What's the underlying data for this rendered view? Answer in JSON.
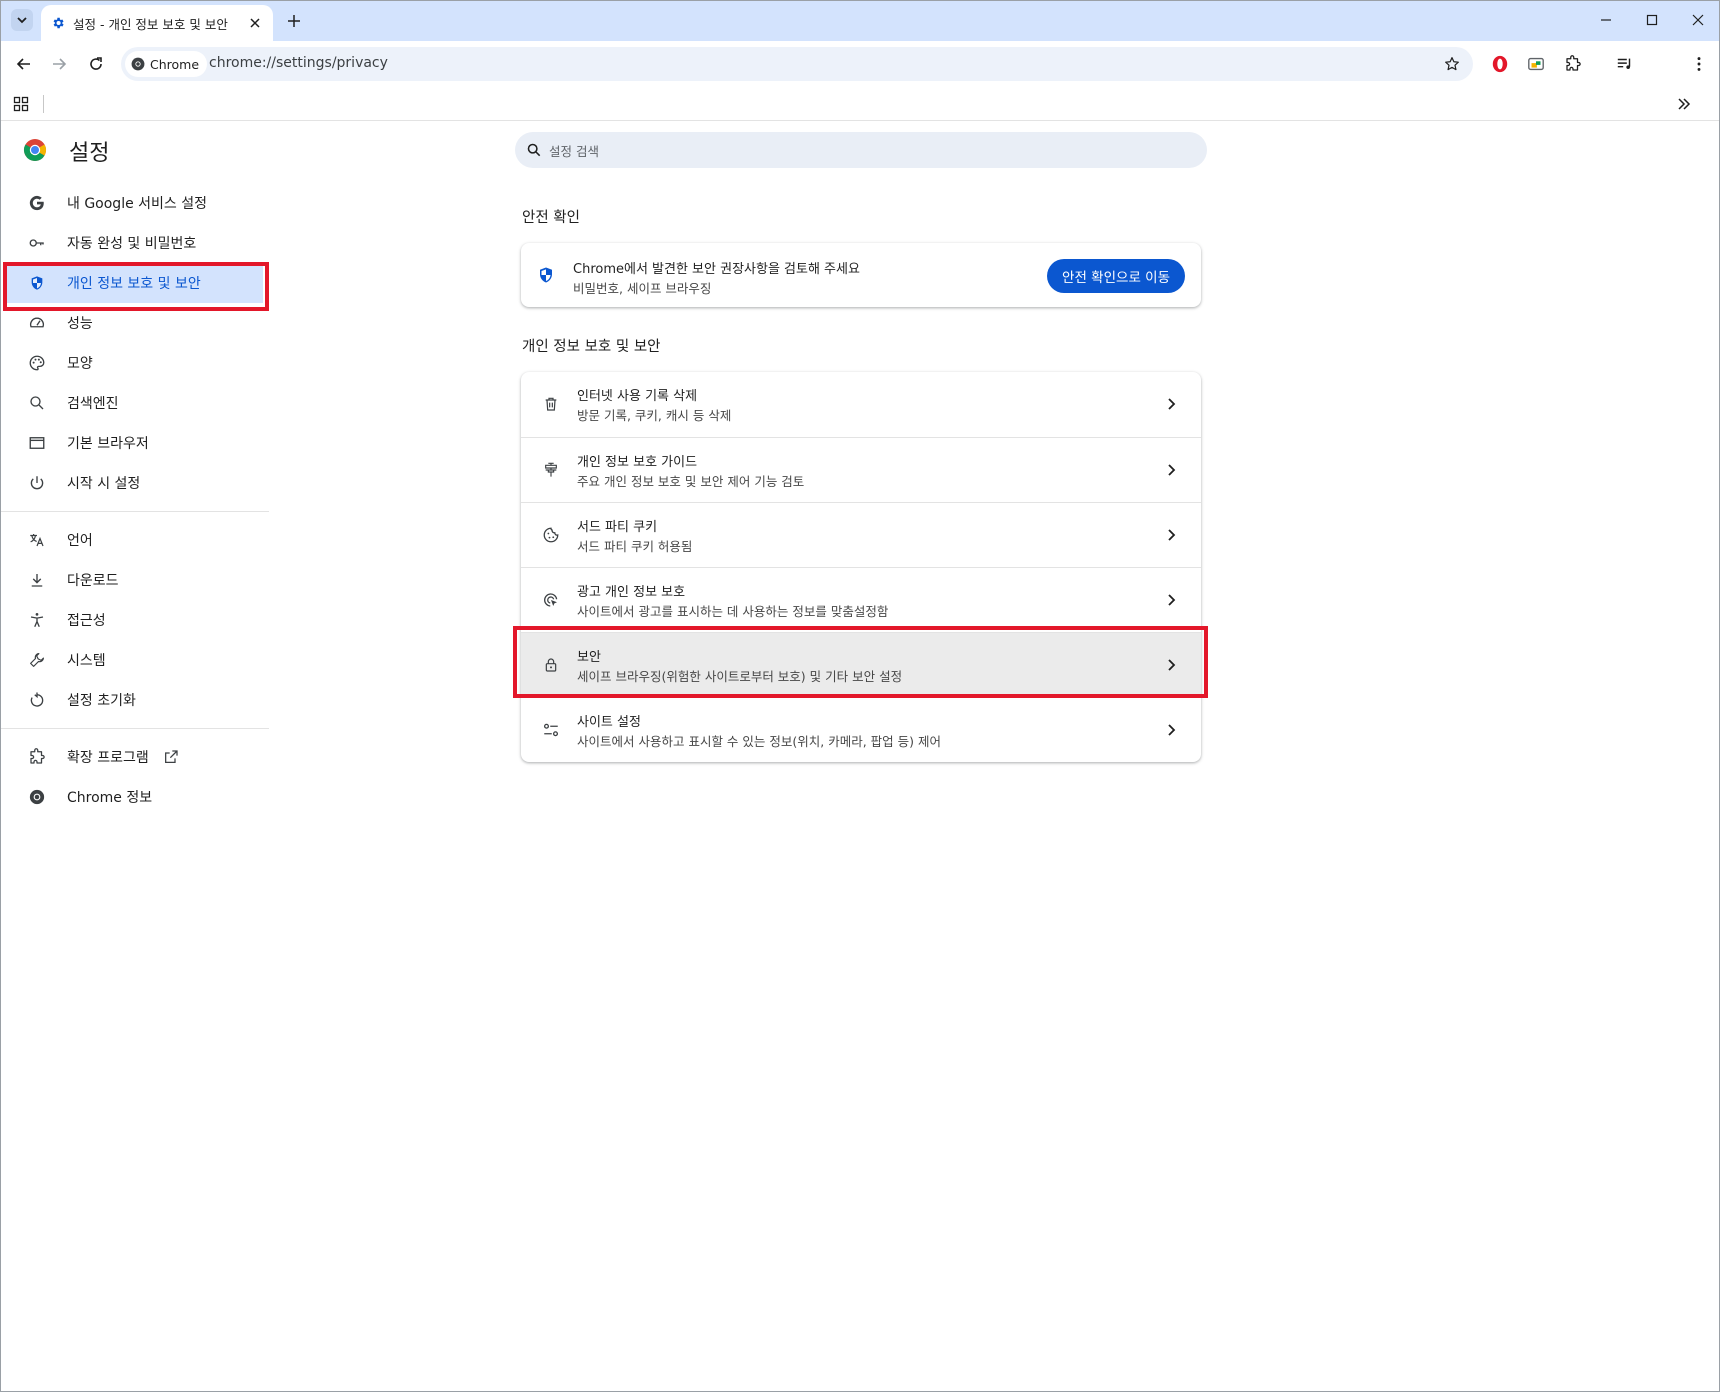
{
  "browser": {
    "tab_title": "설정 - 개인 정보 보호 및 보안",
    "chip_label": "Chrome",
    "url": "chrome://settings/privacy"
  },
  "settings": {
    "title": "설정",
    "search_placeholder": "설정 검색"
  },
  "sidebar": {
    "items": [
      {
        "label": "내 Google 서비스 설정",
        "icon": "google-g-icon"
      },
      {
        "label": "자동 완성 및 비밀번호",
        "icon": "key-icon"
      },
      {
        "label": "개인 정보 보호 및 보안",
        "icon": "shield-icon",
        "active": true
      },
      {
        "label": "성능",
        "icon": "speedometer-icon"
      },
      {
        "label": "모양",
        "icon": "palette-icon"
      },
      {
        "label": "검색엔진",
        "icon": "search-icon"
      },
      {
        "label": "기본 브라우저",
        "icon": "browser-window-icon"
      },
      {
        "label": "시작 시 설정",
        "icon": "power-icon"
      }
    ],
    "items2": [
      {
        "label": "언어",
        "icon": "translate-icon"
      },
      {
        "label": "다운로드",
        "icon": "download-icon"
      },
      {
        "label": "접근성",
        "icon": "accessibility-icon"
      },
      {
        "label": "시스템",
        "icon": "wrench-icon"
      },
      {
        "label": "설정 초기화",
        "icon": "reset-icon"
      }
    ],
    "items3": [
      {
        "label": "확장 프로그램",
        "icon": "puzzle-icon"
      },
      {
        "label": "Chrome 정보",
        "icon": "chrome-icon"
      }
    ]
  },
  "safety_check": {
    "section_title": "안전 확인",
    "line1": "Chrome에서 발견한 보안 권장사항을 검토해 주세요",
    "line2": "비밀번호, 세이프 브라우징",
    "button": "안전 확인으로 이동"
  },
  "privacy": {
    "section_title": "개인 정보 보호 및 보안",
    "rows": [
      {
        "title": "인터넷 사용 기록 삭제",
        "subtitle": "방문 기록, 쿠키, 캐시 등 삭제",
        "icon": "trash-icon"
      },
      {
        "title": "개인 정보 보호 가이드",
        "subtitle": "주요 개인 정보 보호 및 보안 제어 기능 검토",
        "icon": "guide-icon"
      },
      {
        "title": "서드 파티 쿠키",
        "subtitle": "서드 파티 쿠키 허용됨",
        "icon": "cookie-icon"
      },
      {
        "title": "광고 개인 정보 보호",
        "subtitle": "사이트에서 광고를 표시하는 데 사용하는 정보를 맞춤설정함",
        "icon": "ad-privacy-icon"
      },
      {
        "title": "보안",
        "subtitle": "세이프 브라우징(위험한 사이트로부터 보호) 및 기타 보안 설정",
        "icon": "lock-icon",
        "highlighted": true
      },
      {
        "title": "사이트 설정",
        "subtitle": "사이트에서 사용하고 표시할 수 있는 정보(위치, 카메라, 팝업 등) 제어",
        "icon": "tune-icon"
      }
    ]
  },
  "colors": {
    "accent": "#0b57d0",
    "highlight_box": "#e3172a",
    "tabstrip": "#d3e3fd"
  }
}
